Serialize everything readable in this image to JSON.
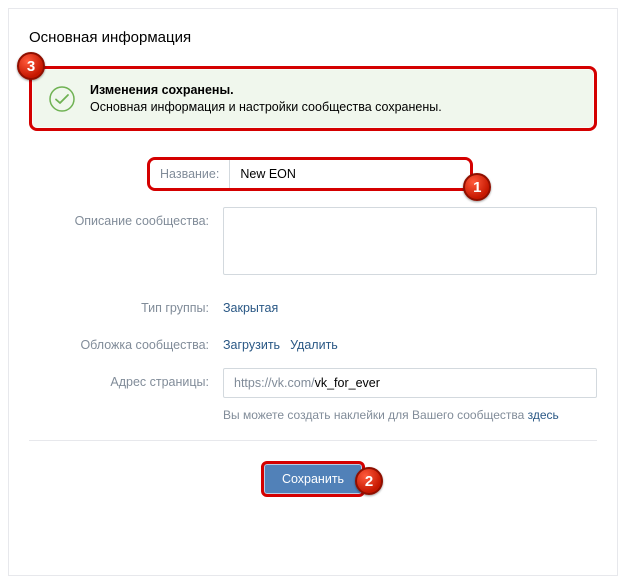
{
  "header": {
    "title": "Основная информация"
  },
  "banner": {
    "title": "Изменения сохранены.",
    "message": "Основная информация и настройки сообщества сохранены."
  },
  "fields": {
    "name": {
      "label": "Название:",
      "value": "New EON"
    },
    "description": {
      "label": "Описание сообщества:",
      "value": ""
    },
    "group_type": {
      "label": "Тип группы:",
      "value": "Закрытая"
    },
    "cover": {
      "label": "Обложка сообщества:",
      "upload": "Загрузить",
      "remove": "Удалить"
    },
    "address": {
      "label": "Адрес страницы:",
      "prefix": "https://vk.com/",
      "value": "vk_for_ever",
      "hint_text": "Вы можете создать наклейки для Вашего сообщества ",
      "hint_link": "здесь"
    }
  },
  "actions": {
    "save": "Сохранить"
  },
  "annotations": {
    "b1": "1",
    "b2": "2",
    "b3": "3"
  }
}
